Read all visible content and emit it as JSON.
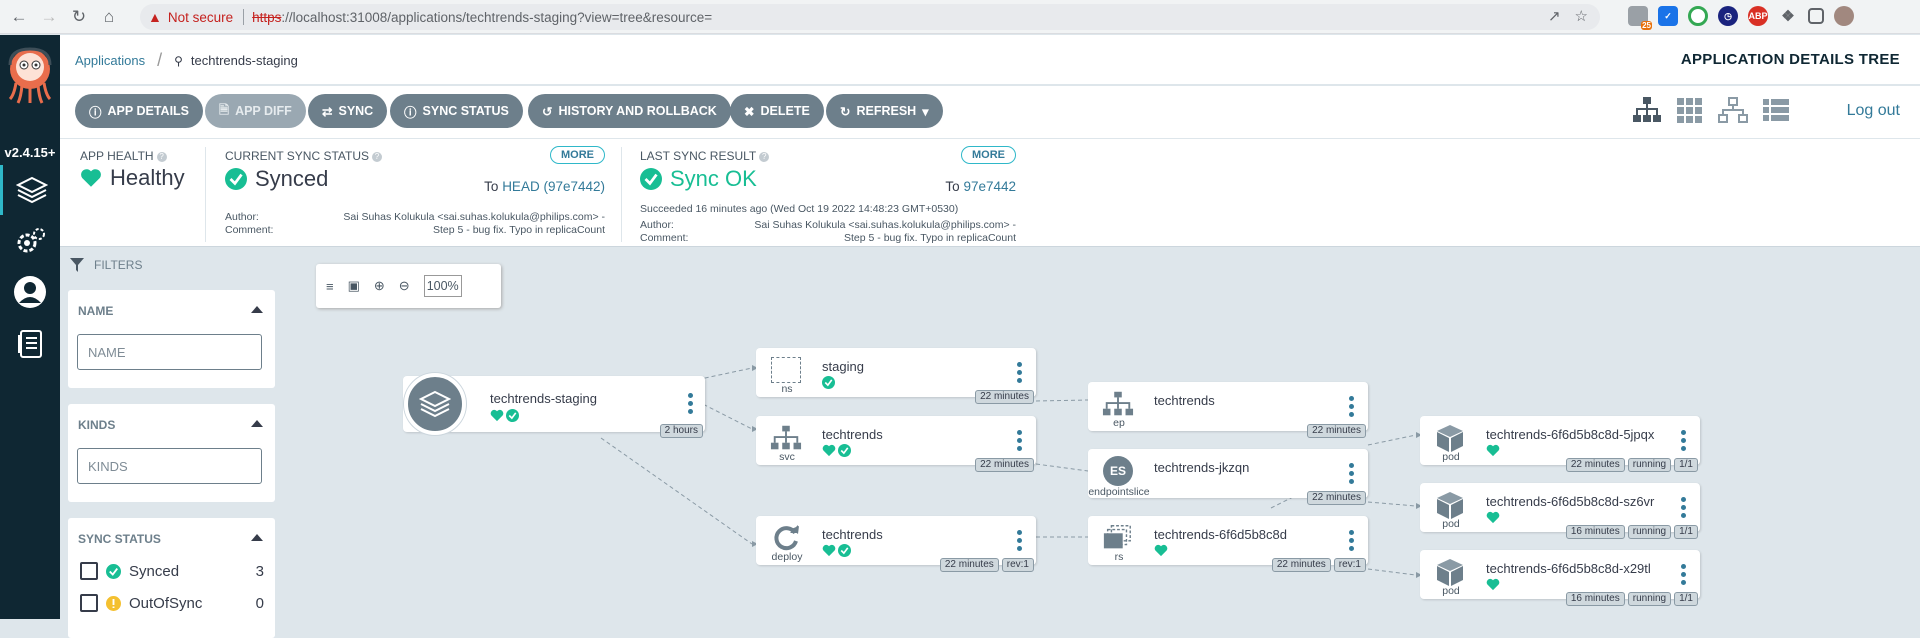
{
  "browser": {
    "not_secure": "Not secure",
    "url_scheme": "https",
    "url_rest": "://localhost:31008/applications/techtrends-staging?view=tree&resource=",
    "ext_badge": "25"
  },
  "nav": {
    "version": "v2.4.15+"
  },
  "header": {
    "breadcrumb_root": "Applications",
    "breadcrumb_current": "techtrends-staging",
    "title": "APPLICATION DETAILS TREE"
  },
  "toolbar": {
    "app_details": "APP DETAILS",
    "app_diff": "APP DIFF",
    "sync": "SYNC",
    "sync_status": "SYNC STATUS",
    "history": "HISTORY AND ROLLBACK",
    "delete": "DELETE",
    "refresh": "REFRESH",
    "logout": "Log out"
  },
  "status": {
    "health_label": "APP HEALTH",
    "health_value": "Healthy",
    "sync_label": "CURRENT SYNC STATUS",
    "sync_value": "Synced",
    "sync_to_prefix": "To",
    "sync_to": "HEAD (97e7442)",
    "more": "MORE",
    "author_label": "Author:",
    "comment_label": "Comment:",
    "author": "Sai Suhas Kolukula <sai.suhas.kolukula@philips.com> -",
    "comment": "Step 5 - bug fix. Typo in replicaCount",
    "last_label": "LAST SYNC RESULT",
    "last_value": "Sync OK",
    "last_to_prefix": "To",
    "last_to": "97e7442",
    "last_time": "Succeeded 16 minutes ago (Wed Oct 19 2022 14:48:23 GMT+0530)",
    "last_author": "Sai Suhas Kolukula <sai.suhas.kolukula@philips.com> -",
    "last_comment": "Step 5 - bug fix. Typo in replicaCount"
  },
  "filters": {
    "title": "FILTERS",
    "name_label": "NAME",
    "name_placeholder": "NAME",
    "kinds_label": "KINDS",
    "kinds_placeholder": "KINDS",
    "sync_label": "SYNC STATUS",
    "synced": "Synced",
    "synced_count": "3",
    "outofsync": "OutOfSync",
    "outofsync_count": "0"
  },
  "graph": {
    "zoom": "100%",
    "app": {
      "name": "techtrends-staging",
      "age": "2 hours"
    },
    "nodes": {
      "ns": {
        "name": "staging",
        "kind": "ns",
        "age": "22 minutes"
      },
      "svc": {
        "name": "techtrends",
        "kind": "svc",
        "age": "22 minutes"
      },
      "deploy": {
        "name": "techtrends",
        "kind": "deploy",
        "age": "22 minutes",
        "rev": "rev:1"
      },
      "ep": {
        "name": "techtrends",
        "kind": "ep",
        "age": "22 minutes"
      },
      "es": {
        "name": "techtrends-jkzqn",
        "kind": "endpointslice",
        "badge": "ES",
        "age": "22 minutes"
      },
      "rs": {
        "name": "techtrends-6f6d5b8c8d",
        "kind": "rs",
        "age": "22 minutes",
        "rev": "rev:1"
      },
      "pod1": {
        "name": "techtrends-6f6d5b8c8d-5jpqx",
        "kind": "pod",
        "age": "22 minutes",
        "state": "running",
        "ready": "1/1"
      },
      "pod2": {
        "name": "techtrends-6f6d5b8c8d-sz6vr",
        "kind": "pod",
        "age": "16 minutes",
        "state": "running",
        "ready": "1/1"
      },
      "pod3": {
        "name": "techtrends-6f6d5b8c8d-x29tl",
        "kind": "pod",
        "age": "16 minutes",
        "state": "running",
        "ready": "1/1"
      }
    }
  },
  "colors": {
    "healthy": "#18be94",
    "accent": "#337a99",
    "nav": "#0f2733",
    "warn": "#f4c030"
  }
}
